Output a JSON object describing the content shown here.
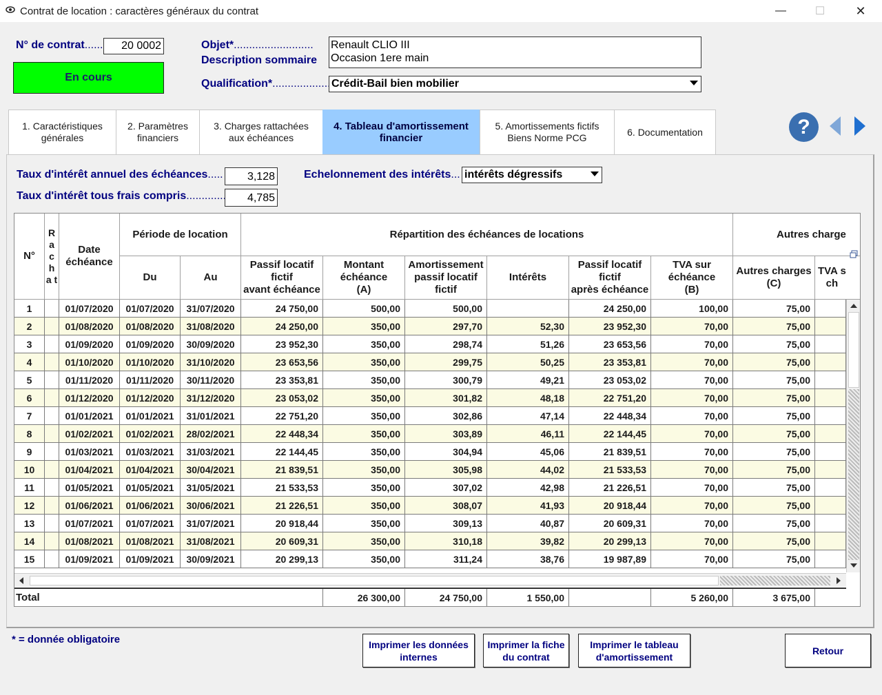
{
  "window": {
    "title": "Contrat de location : caractères généraux du contrat",
    "minimize": "—",
    "maximize": "☐",
    "close": "✕"
  },
  "header": {
    "contract_label": "N° de contrat",
    "contract_value": "20 0002",
    "status": "En cours",
    "status_color": "#00ff00",
    "objet_label": "Objet*",
    "description_label": "Description sommaire",
    "description_line1": "Renault CLIO III",
    "description_line2": "Occasion 1ere main",
    "qualification_label": "Qualification*",
    "qualification_value": "Crédit-Bail bien mobilier"
  },
  "tabs": [
    {
      "label": "1. Caractéristiques\ngénérales"
    },
    {
      "label": "2. Paramètres\nfinanciers"
    },
    {
      "label": "3. Charges rattachées\naux échéances"
    },
    {
      "label": "4. Tableau d'amortissement\nfinancier",
      "active": true
    },
    {
      "label": "5. Amortissements fictifs\nBiens Norme PCG"
    },
    {
      "label": "6. Documentation"
    }
  ],
  "icons": {
    "help": "?",
    "prev": "previous-icon",
    "next": "next-icon"
  },
  "rates": {
    "annual_label": "Taux d'intérêt annuel des échéances",
    "annual_value": "3,128",
    "all_fees_label": "Taux d'intérêt tous frais compris",
    "all_fees_value": "4,785",
    "schedule_label": "Echelonnement des intérêts",
    "schedule_value": "intérêts dégressifs"
  },
  "table": {
    "headers": {
      "no": "N°",
      "rachat": "R\na\nc\nh\na t",
      "date": "Date\néchéance",
      "period": "Période de location",
      "du": "Du",
      "au": "Au",
      "repartition": "Répartition des échéances de locations",
      "autres_group": "Autres charge",
      "passif_avant": "Passif locatif\nfictif\navant échéance",
      "montant": "Montant\néchéance\n(A)",
      "amort": "Amortissement\npassif locatif\nfictif",
      "interets": "Intérêts",
      "passif_apres": "Passif locatif\nfictif\naprès échéance",
      "tva": "TVA sur\néchéance\n(B)",
      "autres": "Autres charges\n(C)",
      "tva_s": "TVA s\nch"
    },
    "rows": [
      [
        "1",
        "01/07/2020",
        "01/07/2020",
        "31/07/2020",
        "24 750,00",
        "500,00",
        "500,00",
        "",
        "24 250,00",
        "100,00",
        "75,00"
      ],
      [
        "2",
        "01/08/2020",
        "01/08/2020",
        "31/08/2020",
        "24 250,00",
        "350,00",
        "297,70",
        "52,30",
        "23 952,30",
        "70,00",
        "75,00"
      ],
      [
        "3",
        "01/09/2020",
        "01/09/2020",
        "30/09/2020",
        "23 952,30",
        "350,00",
        "298,74",
        "51,26",
        "23 653,56",
        "70,00",
        "75,00"
      ],
      [
        "4",
        "01/10/2020",
        "01/10/2020",
        "31/10/2020",
        "23 653,56",
        "350,00",
        "299,75",
        "50,25",
        "23 353,81",
        "70,00",
        "75,00"
      ],
      [
        "5",
        "01/11/2020",
        "01/11/2020",
        "30/11/2020",
        "23 353,81",
        "350,00",
        "300,79",
        "49,21",
        "23 053,02",
        "70,00",
        "75,00"
      ],
      [
        "6",
        "01/12/2020",
        "01/12/2020",
        "31/12/2020",
        "23 053,02",
        "350,00",
        "301,82",
        "48,18",
        "22 751,20",
        "70,00",
        "75,00"
      ],
      [
        "7",
        "01/01/2021",
        "01/01/2021",
        "31/01/2021",
        "22 751,20",
        "350,00",
        "302,86",
        "47,14",
        "22 448,34",
        "70,00",
        "75,00"
      ],
      [
        "8",
        "01/02/2021",
        "01/02/2021",
        "28/02/2021",
        "22 448,34",
        "350,00",
        "303,89",
        "46,11",
        "22 144,45",
        "70,00",
        "75,00"
      ],
      [
        "9",
        "01/03/2021",
        "01/03/2021",
        "31/03/2021",
        "22 144,45",
        "350,00",
        "304,94",
        "45,06",
        "21 839,51",
        "70,00",
        "75,00"
      ],
      [
        "10",
        "01/04/2021",
        "01/04/2021",
        "30/04/2021",
        "21 839,51",
        "350,00",
        "305,98",
        "44,02",
        "21 533,53",
        "70,00",
        "75,00"
      ],
      [
        "11",
        "01/05/2021",
        "01/05/2021",
        "31/05/2021",
        "21 533,53",
        "350,00",
        "307,02",
        "42,98",
        "21 226,51",
        "70,00",
        "75,00"
      ],
      [
        "12",
        "01/06/2021",
        "01/06/2021",
        "30/06/2021",
        "21 226,51",
        "350,00",
        "308,07",
        "41,93",
        "20 918,44",
        "70,00",
        "75,00"
      ],
      [
        "13",
        "01/07/2021",
        "01/07/2021",
        "31/07/2021",
        "20 918,44",
        "350,00",
        "309,13",
        "40,87",
        "20 609,31",
        "70,00",
        "75,00"
      ],
      [
        "14",
        "01/08/2021",
        "01/08/2021",
        "31/08/2021",
        "20 609,31",
        "350,00",
        "310,18",
        "39,82",
        "20 299,13",
        "70,00",
        "75,00"
      ],
      [
        "15",
        "01/09/2021",
        "01/09/2021",
        "30/09/2021",
        "20 299,13",
        "350,00",
        "311,24",
        "38,76",
        "19 987,89",
        "70,00",
        "75,00"
      ]
    ],
    "total": {
      "label": "Total",
      "montant": "26 300,00",
      "amort": "24 750,00",
      "interets": "1 550,00",
      "tva": "5 260,00",
      "autres": "3 675,00"
    }
  },
  "footer": {
    "mandatory_note": "* = donnée obligatoire",
    "print_internal": "Imprimer les données\ninternes",
    "print_sheet": "Imprimer la fiche\ndu contrat",
    "print_table": "Imprimer le tableau\nd'amortissement",
    "back": "Retour"
  }
}
